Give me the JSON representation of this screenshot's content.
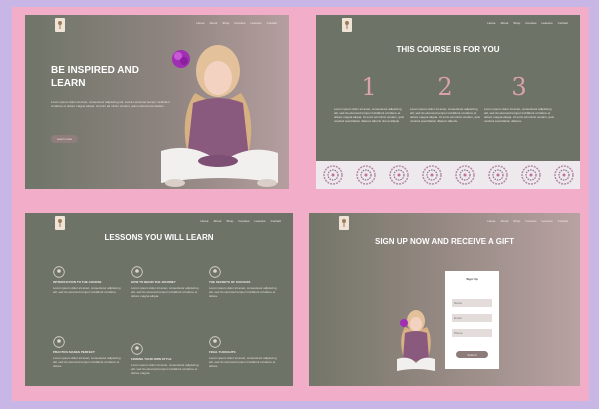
{
  "colors": {
    "background": "#c8b6e6",
    "frame": "#f2aec9",
    "sage": "#6e7367",
    "accent_rose": "#d9a3a8",
    "button": "#8e7d7b"
  },
  "nav": {
    "items": [
      "Home",
      "About",
      "Shop",
      "Courses",
      "Lessons",
      "Contact"
    ]
  },
  "hero": {
    "title": "BE INSPIRED AND LEARN",
    "text": "Lorem ipsum dolor sit amet, consectetur adipiscing elit, sed do eiusmod tempor incididunt ut labore et dolore magna aliqua. Ut enim ad minim veniam, quis nostrud exercitation.",
    "button": "Learn more"
  },
  "course": {
    "title": "THIS COURSE IS FOR YOU",
    "columns": [
      {
        "number": "1",
        "text": "Lorem ipsum dolor sit amet, consectetur adipiscing elit, sed do eiusmod tempor incididunt ut labore et dolore magna aliqua. Ut enim ad minim veniam, quis nostrud exercitation ullamco laboris nisi ut aliquip."
      },
      {
        "number": "2",
        "text": "Lorem ipsum dolor sit amet, consectetur adipiscing elit, sed do eiusmod tempor incididunt ut labore et dolore magna aliqua. Ut enim ad minim veniam, quis nostrud exercitation ullamco laboris."
      },
      {
        "number": "3",
        "text": "Lorem ipsum dolor sit amet, consectetur adipiscing elit, sed do eiusmod tempor incididunt ut labore et dolore magna aliqua. Ut enim ad minim veniam, quis nostrud exercitation ullamco."
      }
    ]
  },
  "lessons": {
    "title": "LESSONS YOU WILL LEARN",
    "items": [
      {
        "name": "INTRODUCTION TO THE COURSE",
        "text": "Lorem ipsum dolor sit amet, consectetur adipiscing elit, sed do eiusmod tempor incididunt ut labore."
      },
      {
        "name": "HOW TO BEGIN THE JOURNEY",
        "text": "Lorem ipsum dolor sit amet, consectetur adipiscing elit, sed do eiusmod tempor incididunt ut labore et dolore magna aliqua."
      },
      {
        "name": "THE SECRETS OF SUCCESS",
        "text": "Lorem ipsum dolor sit amet, consectetur adipiscing elit, sed do eiusmod tempor incididunt ut labore et dolore."
      },
      {
        "name": "PRACTICE MAKES PERFECT",
        "text": "Lorem ipsum dolor sit amet, consectetur adipiscing elit, sed do eiusmod tempor incididunt ut labore et dolore."
      },
      {
        "name": "FINDING YOUR OWN STYLE",
        "text": "Lorem ipsum dolor sit amet, consectetur adipiscing elit, sed do eiusmod tempor incididunt ut labore et dolore magna."
      },
      {
        "name": "FINAL THOUGHTS",
        "text": "Lorem ipsum dolor sit amet, consectetur adipiscing elit, sed do eiusmod tempor incididunt ut labore et dolore."
      }
    ]
  },
  "signup": {
    "title": "SIGN UP NOW AND RECEIVE A GIFT",
    "form_title": "Sign Up",
    "name_placeholder": "Name",
    "email_placeholder": "Email",
    "phone_placeholder": "Phone",
    "button": "Submit"
  },
  "icons": {
    "logo": "brand-logo-icon",
    "lesson": "lesson-emblem-icon",
    "strip": "floral-swirl-icon",
    "flower": "purple-flower-icon"
  }
}
